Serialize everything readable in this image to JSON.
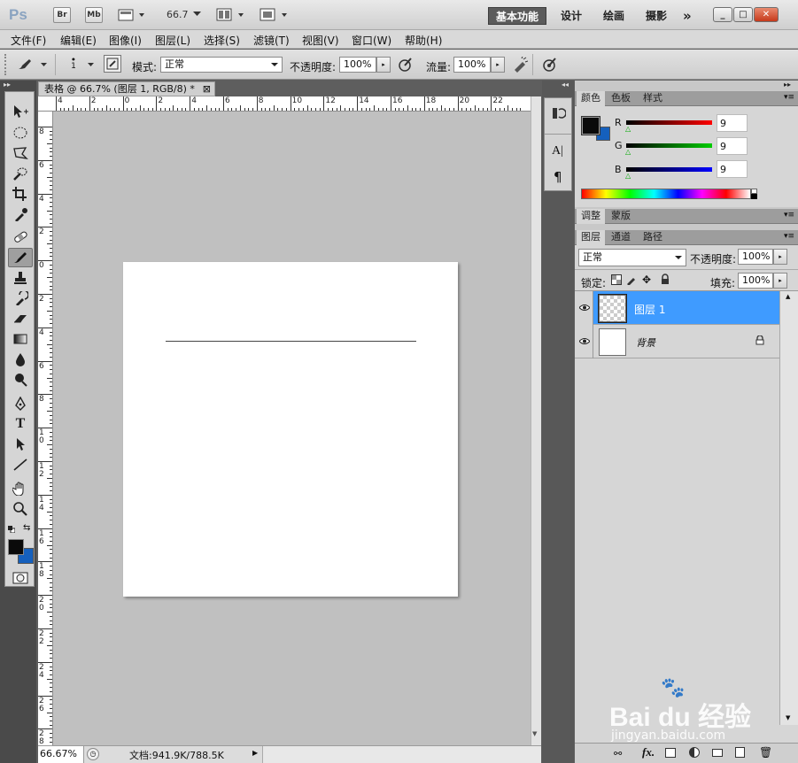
{
  "titlebar": {
    "logo": "Ps",
    "br": "Br",
    "mb": "Mb",
    "zoom": "66.7",
    "workspaces": [
      "基本功能",
      "设计",
      "绘画",
      "摄影"
    ],
    "more": "»",
    "minimize": "_",
    "maximize": "□",
    "close": "✕"
  },
  "menu": [
    "文件(F)",
    "编辑(E)",
    "图像(I)",
    "图层(L)",
    "选择(S)",
    "滤镜(T)",
    "视图(V)",
    "窗口(W)",
    "帮助(H)"
  ],
  "options": {
    "brush_size": "1",
    "mode_label": "模式:",
    "mode_value": "正常",
    "opacity_label": "不透明度:",
    "opacity_value": "100%",
    "flow_label": "流量:",
    "flow_value": "100%"
  },
  "document": {
    "tab_title": "表格 @ 66.7% (图层 1, RGB/8) *",
    "close": "⊠",
    "h_ruler": [
      "4",
      "2",
      "0",
      "2",
      "4",
      "6",
      "8",
      "10",
      "12",
      "14",
      "16",
      "18",
      "20",
      "22"
    ],
    "v_ruler": [
      "8",
      "6",
      "4",
      "2",
      "0",
      "2",
      "4",
      "6",
      "8",
      "1 0",
      "1 2",
      "1 4",
      "1 6",
      "1 8",
      "2 0",
      "2 2",
      "2 4",
      "2 6",
      "2 8"
    ]
  },
  "status": {
    "zoom": "66.67%",
    "doc_info": "文档:941.9K/788.5K"
  },
  "colors": {
    "foreground": "#0a0a0a",
    "background": "#1560bd",
    "tabs": [
      "颜色",
      "色板",
      "样式"
    ],
    "r_label": "R",
    "g_label": "G",
    "b_label": "B",
    "r_value": "9",
    "g_value": "9",
    "b_value": "9"
  },
  "adjust": {
    "tabs": [
      "调整",
      "蒙版"
    ]
  },
  "layers": {
    "tabs": [
      "图层",
      "通道",
      "路径"
    ],
    "blend_mode": "正常",
    "opacity_label": "不透明度:",
    "opacity_value": "100%",
    "lock_label": "锁定:",
    "fill_label": "填充:",
    "fill_value": "100%",
    "items": [
      {
        "name": "图层 1"
      },
      {
        "name": "背景"
      }
    ]
  },
  "watermark": {
    "brand": "Bai du 经验",
    "url": "jingyan.baidu.com"
  }
}
